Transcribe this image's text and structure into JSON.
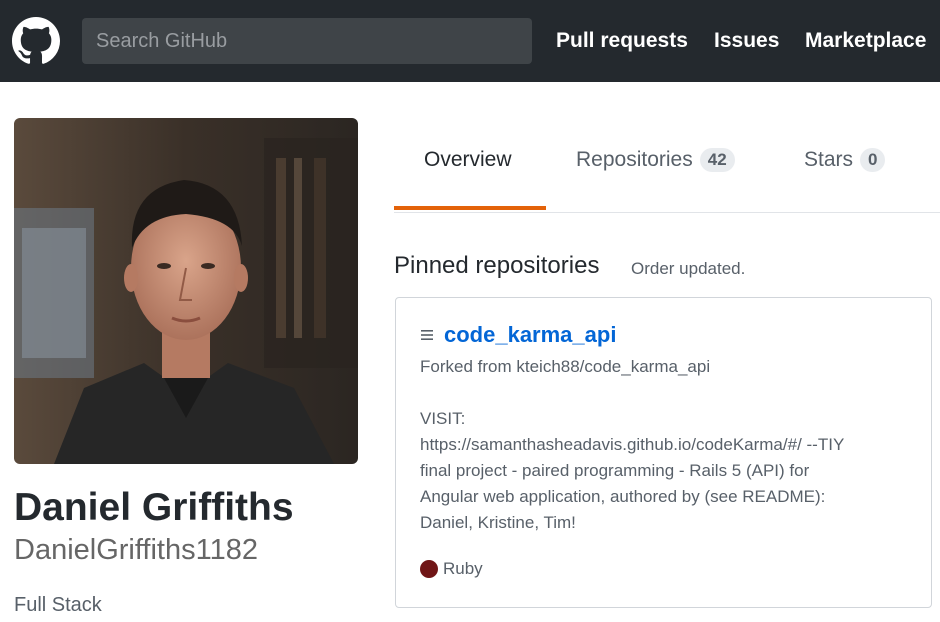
{
  "header": {
    "search_placeholder": "Search GitHub",
    "nav": [
      "Pull requests",
      "Issues",
      "Marketplace"
    ]
  },
  "profile": {
    "name": "Daniel Griffiths",
    "username": "DanielGriffiths1182",
    "bio": "Full Stack"
  },
  "tabs": [
    {
      "label": "Overview",
      "selected": true
    },
    {
      "label": "Repositories",
      "count": "42"
    },
    {
      "label": "Stars",
      "count": "0"
    }
  ],
  "pinned": {
    "title": "Pinned repositories",
    "note": "Order updated.",
    "repo": {
      "name": "code_karma_api",
      "forked_prefix": "Forked from ",
      "forked_source": "kteich88/code_karma_api",
      "description_lines": [
        "VISIT:",
        "https://samanthasheadavis.github.io/codeKarma/#/ --TIY",
        "final project - paired programming - Rails 5 (API) for",
        "Angular web application, authored by (see README):",
        "Daniel, Kristine, Tim!"
      ],
      "language": "Ruby",
      "language_color": "#701516"
    }
  },
  "colors": {
    "header_bg": "#24292e",
    "link": "#0366d6",
    "tab_accent": "#e36209"
  }
}
